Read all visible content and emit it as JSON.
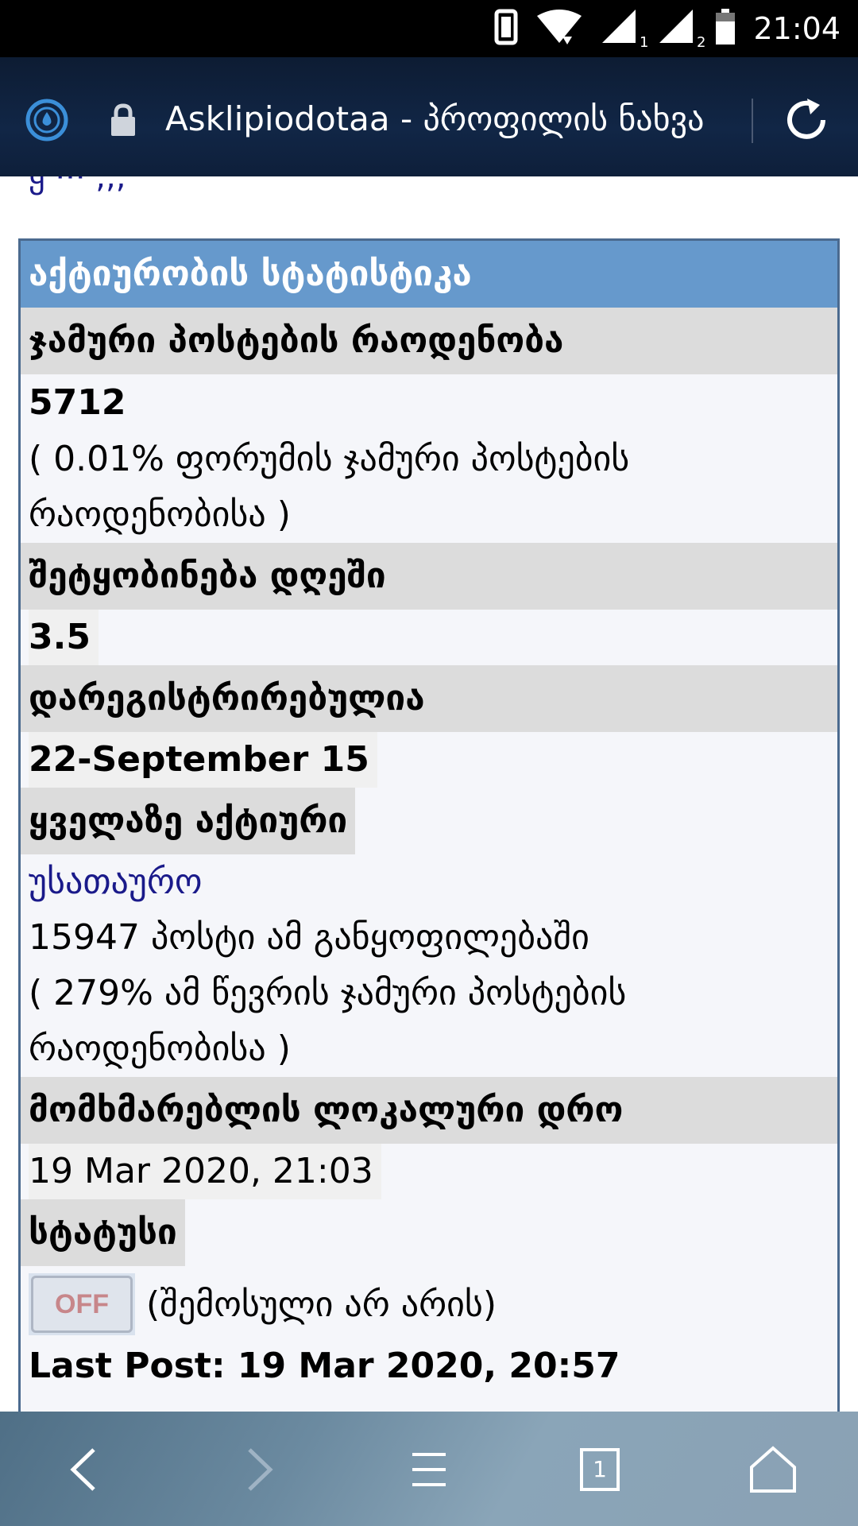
{
  "status_bar": {
    "time": "21:04",
    "sim1": "1",
    "sim2": "2"
  },
  "browser": {
    "page_title": "Asklipiodotaa - პროფილის ნახვა",
    "icons": [
      "drop-icon",
      "lock-icon",
      "reload-icon"
    ]
  },
  "peek_text": "ყ ··· ,,,",
  "stats": {
    "header": "აქტიურობის სტატისტიკა",
    "total_posts_label": "ჯამური პოსტების რაოდენობა",
    "total_posts_value": "5712",
    "total_posts_share_line1": "( 0.01% ფორუმის ჯამური პოსტების",
    "total_posts_share_line2": "რაოდენობისა )",
    "posts_per_day_label": "შეტყობინება დღეში",
    "posts_per_day_value": "3.5",
    "registered_label": "დარეგისტრირებულია",
    "registered_value": "22-September 15",
    "most_active_label": "ყველაზე აქტიური",
    "most_active_link": "უსათაურო",
    "most_active_posts": "15947 პოსტი ამ განყოფილებაში",
    "most_active_share_line1": "( 279% ამ წევრის ჯამური პოსტების",
    "most_active_share_line2": "რაოდენობისა )",
    "local_time_label": "მომხმარებლის ლოკალური დრო",
    "local_time_value": "19 Mar 2020, 21:03",
    "status_label": "სტატუსი",
    "status_badge": "OFF",
    "status_text": "(შემოსული არ არის)",
    "last_post_partial": "Last Post:  19 Mar 2020, 20:57"
  },
  "bottom_nav": {
    "tab_count": "1",
    "buttons": [
      "back-icon",
      "forward-icon",
      "menu-icon",
      "tabs-icon",
      "home-icon"
    ]
  }
}
